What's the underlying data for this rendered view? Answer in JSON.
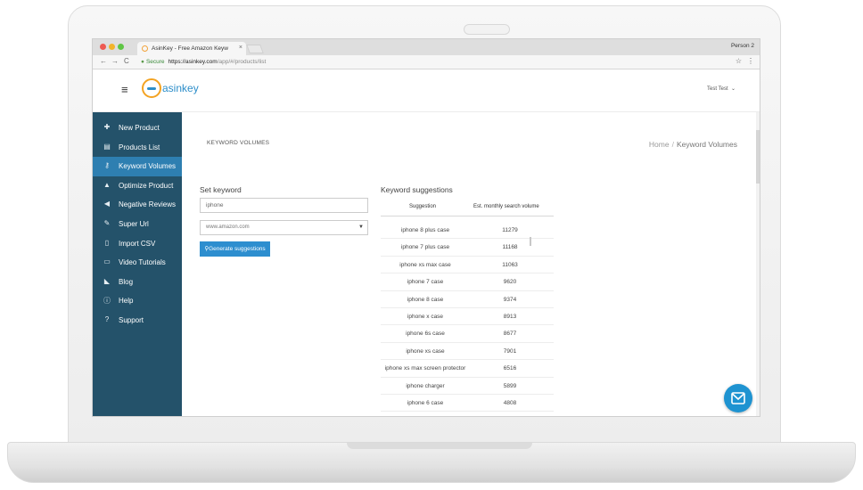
{
  "browser": {
    "tab_title": "AsinKey - Free Amazon Keyw",
    "tab_close": "×",
    "profile": "Person 2",
    "secure_label": "Secure",
    "url_main": "https://asinkey.com",
    "url_path": "/app/#/products/list"
  },
  "header": {
    "logo_text": "asinkey",
    "user_name": "Test Test"
  },
  "sidebar": {
    "items": [
      {
        "label": "New Product",
        "icon": "plus-icon"
      },
      {
        "label": "Products List",
        "icon": "list-icon"
      },
      {
        "label": "Keyword Volumes",
        "icon": "key-icon",
        "active": true
      },
      {
        "label": "Optimize Product",
        "icon": "flask-icon"
      },
      {
        "label": "Negative Reviews",
        "icon": "megaphone-icon"
      },
      {
        "label": "Super Url",
        "icon": "link-icon"
      },
      {
        "label": "Import CSV",
        "icon": "file-icon"
      },
      {
        "label": "Video Tutorials",
        "icon": "video-icon"
      },
      {
        "label": "Blog",
        "icon": "rss-icon"
      },
      {
        "label": "Help",
        "icon": "info-icon"
      },
      {
        "label": "Support",
        "icon": "question-icon"
      }
    ]
  },
  "page": {
    "title": "KEYWORD VOLUMES",
    "breadcrumb_home": "Home",
    "breadcrumb_sep": "/",
    "breadcrumb_current": "Keyword Volumes"
  },
  "form": {
    "set_keyword_label": "Set keyword",
    "keyword_value": "iphone",
    "domain_value": "www.amazon.com",
    "generate_label": "Generate suggestions"
  },
  "suggestions": {
    "label": "Keyword suggestions",
    "col_suggestion": "Suggestion",
    "col_volume": "Est. monthly search volume",
    "rows": [
      {
        "suggestion": "iphone 8 plus case",
        "volume": "11279"
      },
      {
        "suggestion": "iphone 7 plus case",
        "volume": "11168"
      },
      {
        "suggestion": "iphone xs max case",
        "volume": "11063"
      },
      {
        "suggestion": "iphone 7 case",
        "volume": "9620"
      },
      {
        "suggestion": "iphone 8 case",
        "volume": "9374"
      },
      {
        "suggestion": "iphone x case",
        "volume": "8913"
      },
      {
        "suggestion": "iphone 6s case",
        "volume": "8677"
      },
      {
        "suggestion": "iphone xs case",
        "volume": "7901"
      },
      {
        "suggestion": "iphone xs max screen protector",
        "volume": "6516"
      },
      {
        "suggestion": "iphone charger",
        "volume": "5899"
      },
      {
        "suggestion": "iphone 6 case",
        "volume": "4808"
      }
    ]
  },
  "colors": {
    "sidebar_bg": "#24526a",
    "sidebar_active": "#2e7fb1",
    "primary_button": "#2d8ecf",
    "chat_button": "#1e93d1"
  }
}
